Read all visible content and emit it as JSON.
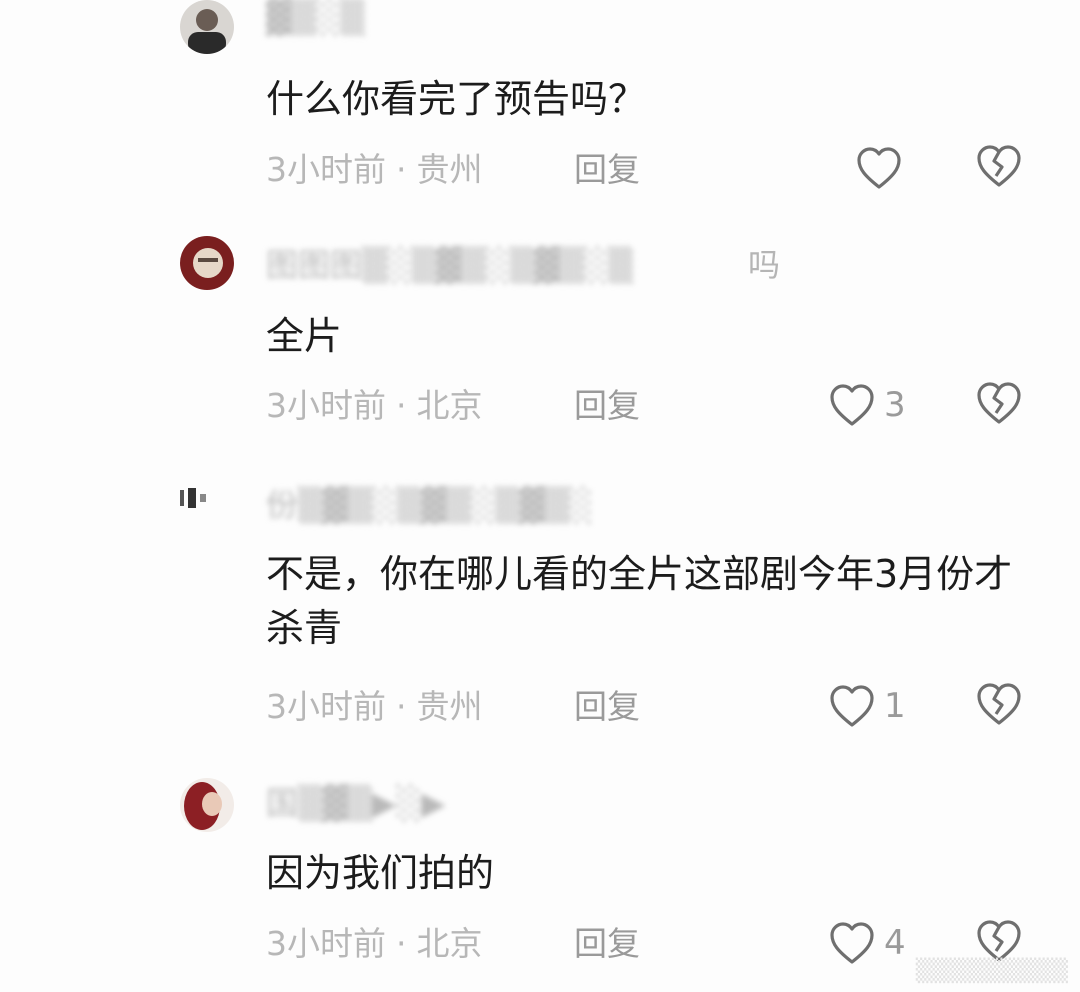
{
  "comments": [
    {
      "avatar": "avatar-photo",
      "username_tail": "",
      "text": "什么你看完了预告吗？",
      "time": "3小时前",
      "location": "贵州",
      "reply_label": "回复",
      "likes": ""
    },
    {
      "avatar": "avatar-photo",
      "username_tail": "吗",
      "text": "全片",
      "time": "3小时前",
      "location": "北京",
      "reply_label": "回复",
      "likes": "3"
    },
    {
      "avatar": "avatar-photo",
      "username_tail": "",
      "text": "不是，你在哪儿看的全片这部剧今年3月份才杀青",
      "time": "3小时前",
      "location": "贵州",
      "reply_label": "回复",
      "likes": "1"
    },
    {
      "avatar": "avatar-photo",
      "username_tail": "",
      "text": "因为我们拍的",
      "time": "3小时前",
      "location": "北京",
      "reply_label": "回复",
      "likes": "4"
    }
  ],
  "colors": {
    "text": "#1c1c1c",
    "meta": "#b7b7b7",
    "action": "#9a9a9a"
  }
}
